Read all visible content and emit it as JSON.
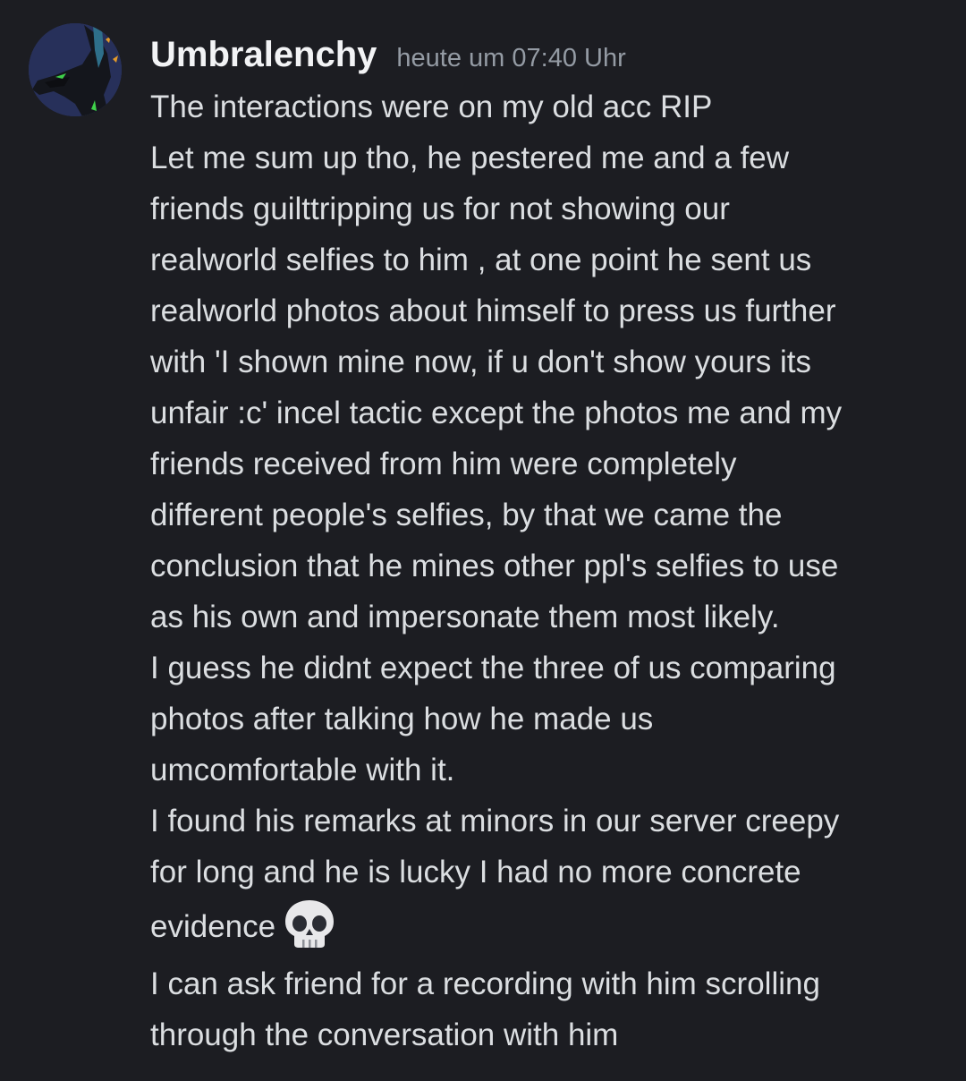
{
  "message": {
    "username": "Umbralenchy",
    "timestamp": "heute um 07:40 Uhr",
    "lines": [
      "The interactions were on my old acc RIP",
      "Let me sum up tho, he pestered me and a few",
      "friends guilttripping us for not showing our",
      "realworld selfies to him , at one point he sent us",
      "realworld photos about himself to press us further",
      "with 'I shown mine now, if u don't show yours its",
      "unfair :c' incel tactic except the photos me and my",
      "friends received from him were completely",
      "different people's selfies, by that we came the",
      "conclusion that he mines other ppl's selfies to use",
      "as his own and impersonate them most likely.",
      "I guess he didnt expect the three of us comparing",
      "photos after talking how he made us",
      "umcomfortable with it.",
      "I found his remarks at minors in our server creepy",
      "for long and he is lucky I had no more concrete",
      "evidence",
      "I can ask friend for a recording with him scrolling",
      "through the conversation with him"
    ],
    "emoji": "skull-icon"
  },
  "colors": {
    "background": "#1c1d22",
    "username": "#f2f3f5",
    "timestamp": "#949ba4",
    "text": "#dbdee1",
    "avatar_bg": "#2a3358",
    "avatar_accent": "#3fd14a"
  }
}
